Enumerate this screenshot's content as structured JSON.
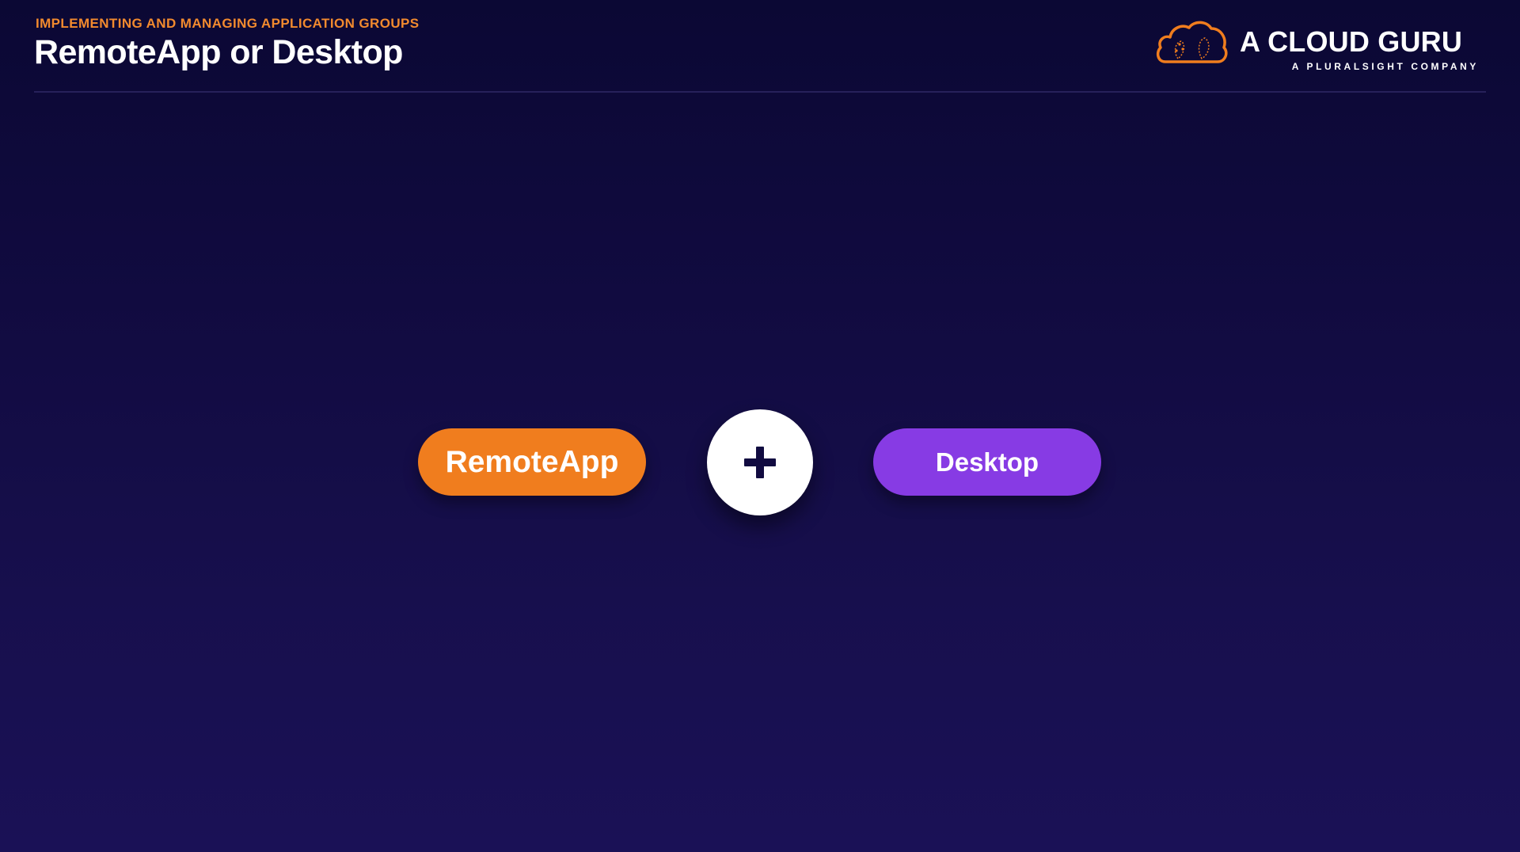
{
  "header": {
    "kicker": "IMPLEMENTING AND MANAGING APPLICATION GROUPS",
    "title": "RemoteApp or Desktop"
  },
  "logo": {
    "name": "A CLOUD GURU",
    "tagline": "A PLURALSIGHT COMPANY",
    "icon": "cloud-logo-icon"
  },
  "diagram": {
    "left_label": "RemoteApp",
    "right_label": "Desktop",
    "operator_icon": "plus-icon"
  },
  "colors": {
    "accent_orange": "#f07d1e",
    "accent_purple": "#873be4",
    "kicker_orange": "#f28a2e",
    "background_dark": "#110b40"
  }
}
